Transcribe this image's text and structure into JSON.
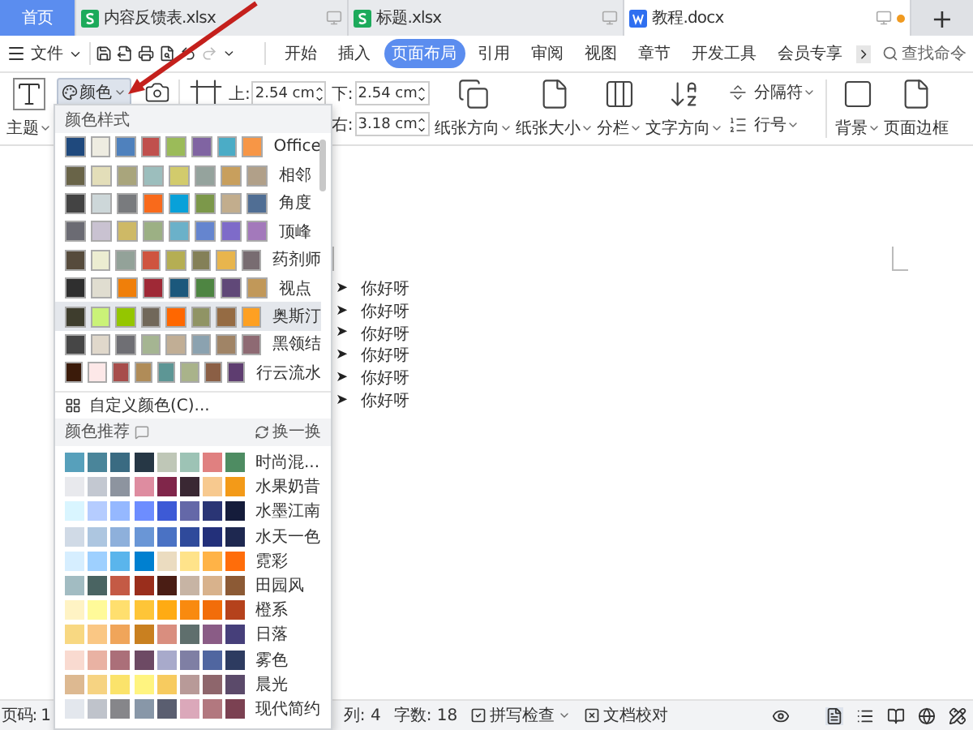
{
  "tabs": [
    {
      "label": "首页",
      "kind": "home",
      "selected": false,
      "modified": false
    },
    {
      "label": "内容反馈表.xlsx",
      "kind": "sheet",
      "selected": false,
      "modified": false
    },
    {
      "label": "标题.xlsx",
      "kind": "sheet",
      "selected": false,
      "modified": false
    },
    {
      "label": "教程.docx",
      "kind": "doc",
      "selected": true,
      "modified": true
    }
  ],
  "new_tab": "+",
  "file_menu": "文件",
  "menu_tabs": [
    {
      "label": "开始",
      "selected": false
    },
    {
      "label": "插入",
      "selected": false
    },
    {
      "label": "页面布局",
      "selected": true
    },
    {
      "label": "引用",
      "selected": false
    },
    {
      "label": "审阅",
      "selected": false
    },
    {
      "label": "视图",
      "selected": false
    },
    {
      "label": "章节",
      "selected": false
    },
    {
      "label": "开发工具",
      "selected": false
    },
    {
      "label": "会员专享",
      "selected": false
    }
  ],
  "search": {
    "placeholder": "查找命令"
  },
  "ribbon": {
    "theme": "主题",
    "color_button": "颜色",
    "margins": [
      {
        "label": "上:",
        "value": "2.54 cm"
      },
      {
        "label": "下:",
        "value": "2.54 cm"
      },
      {
        "label": "右:",
        "value": "3.18 cm"
      }
    ],
    "tools": [
      {
        "label": "纸张方向",
        "kind": "orientation",
        "dropdown": true
      },
      {
        "label": "纸张大小",
        "kind": "size",
        "dropdown": true
      },
      {
        "label": "分栏",
        "kind": "columns",
        "dropdown": true
      },
      {
        "label": "文字方向",
        "kind": "direction",
        "dropdown": true
      },
      {
        "label": "分隔符",
        "kind": "separator",
        "dropdown": true
      },
      {
        "label": "行号",
        "kind": "linenumber",
        "dropdown": true
      },
      {
        "label": "背景",
        "kind": "background",
        "dropdown": true
      },
      {
        "label": "页面边框",
        "kind": "border",
        "dropdown": false
      }
    ]
  },
  "color_menu": {
    "styles_title": "颜色样式",
    "styles": [
      {
        "name": "Office",
        "selected": false,
        "swatches": [
          {
            "color": "#1f497d"
          },
          {
            "color": "#eeece1"
          },
          {
            "color": "#4f81bd"
          },
          {
            "color": "#c0504d"
          },
          {
            "color": "#9bbb59"
          },
          {
            "color": "#8064a2"
          },
          {
            "color": "#4bacc6"
          },
          {
            "color": "#f79646"
          }
        ]
      },
      {
        "name": "相邻",
        "selected": false,
        "swatches": [
          {
            "color": "#696448"
          },
          {
            "color": "#e3deb9"
          },
          {
            "color": "#a9a57c"
          },
          {
            "color": "#9cbebd"
          },
          {
            "color": "#d2cb6c"
          },
          {
            "color": "#95a39d"
          },
          {
            "color": "#c89f5d"
          },
          {
            "color": "#b1a089"
          }
        ]
      },
      {
        "name": "角度",
        "selected": false,
        "swatches": [
          {
            "color": "#434343"
          },
          {
            "color": "#cdd7d9"
          },
          {
            "color": "#797b7e"
          },
          {
            "color": "#f96a1b"
          },
          {
            "color": "#08a1d9"
          },
          {
            "color": "#7c984a"
          },
          {
            "color": "#c2ad8d"
          },
          {
            "color": "#506e94"
          }
        ]
      },
      {
        "name": "顶峰",
        "selected": false,
        "swatches": [
          {
            "color": "#6b6b73"
          },
          {
            "color": "#c9c2d1"
          },
          {
            "color": "#ceb966"
          },
          {
            "color": "#9cb084"
          },
          {
            "color": "#6bb1c9"
          },
          {
            "color": "#6585cf"
          },
          {
            "color": "#7e6bc9"
          },
          {
            "color": "#a379bb"
          }
        ]
      },
      {
        "name": "药剂师",
        "selected": false,
        "swatches": [
          {
            "color": "#564b3c"
          },
          {
            "color": "#ecedd1"
          },
          {
            "color": "#93a299"
          },
          {
            "color": "#cf543f"
          },
          {
            "color": "#b5ae53"
          },
          {
            "color": "#848058"
          },
          {
            "color": "#e8b54d"
          },
          {
            "color": "#786c71"
          }
        ]
      },
      {
        "name": "视点",
        "selected": false,
        "swatches": [
          {
            "color": "#2f2f2f"
          },
          {
            "color": "#e0ddd0"
          },
          {
            "color": "#f07f09"
          },
          {
            "color": "#9f2936"
          },
          {
            "color": "#1b587c"
          },
          {
            "color": "#4e8542"
          },
          {
            "color": "#604878"
          },
          {
            "color": "#c19859"
          }
        ]
      },
      {
        "name": "奥斯汀",
        "selected": true,
        "swatches": [
          {
            "color": "#3e3d2d"
          },
          {
            "color": "#caf278"
          },
          {
            "color": "#94c600"
          },
          {
            "color": "#71685a"
          },
          {
            "color": "#ff6700"
          },
          {
            "color": "#909465"
          },
          {
            "color": "#956b43"
          },
          {
            "color": "#fea022"
          }
        ]
      },
      {
        "name": "黑领结",
        "selected": false,
        "swatches": [
          {
            "color": "#464646"
          },
          {
            "color": "#e0d8cb"
          },
          {
            "color": "#6f6f74"
          },
          {
            "color": "#a5b592"
          },
          {
            "color": "#c1ae95"
          },
          {
            "color": "#8ba2b0"
          },
          {
            "color": "#a08466"
          },
          {
            "color": "#8e6a73"
          }
        ]
      },
      {
        "name": "行云流水",
        "selected": false,
        "swatches": [
          {
            "color": "#3b1b0a"
          },
          {
            "color": "#fde8e8"
          },
          {
            "color": "#a74d4b"
          },
          {
            "color": "#b08c58"
          },
          {
            "color": "#5d9695"
          },
          {
            "color": "#a9b38a"
          },
          {
            "color": "#8b5f45"
          },
          {
            "color": "#5e3d70"
          }
        ]
      }
    ],
    "custom": "自定义颜色(C)...",
    "recommend_title": "颜色推荐",
    "refresh": "换一换",
    "recommended": [
      {
        "name": "时尚混...",
        "swatches": [
          {
            "color": "#57a0bb"
          },
          {
            "color": "#4a859a"
          },
          {
            "color": "#3a6b82"
          },
          {
            "color": "#263745"
          },
          {
            "color": "#bfc7b7"
          },
          {
            "color": "#9dc3b5"
          },
          {
            "color": "#e08080"
          },
          {
            "color": "#4e8c62"
          }
        ]
      },
      {
        "name": "水果奶昔",
        "swatches": [
          {
            "color": "#e8e9ed"
          },
          {
            "color": "#c3c8d1"
          },
          {
            "color": "#8d949f"
          },
          {
            "color": "#de8ca0"
          },
          {
            "color": "#80264a"
          },
          {
            "color": "#3a2833"
          },
          {
            "color": "#f7c98f"
          },
          {
            "color": "#f39a18"
          }
        ]
      },
      {
        "name": "水墨江南",
        "swatches": [
          {
            "color": "#d9f5ff"
          },
          {
            "color": "#b5ccff"
          },
          {
            "color": "#95b8ff"
          },
          {
            "color": "#6d8dff"
          },
          {
            "color": "#3d5ad6"
          },
          {
            "color": "#6468a8"
          },
          {
            "color": "#2a3575"
          },
          {
            "color": "#151c3b"
          }
        ]
      },
      {
        "name": "水天一色",
        "swatches": [
          {
            "color": "#d0dae6"
          },
          {
            "color": "#adc6e0"
          },
          {
            "color": "#8eb0db"
          },
          {
            "color": "#6a96d6"
          },
          {
            "color": "#4a72c4"
          },
          {
            "color": "#2f4a9b"
          },
          {
            "color": "#23307a"
          },
          {
            "color": "#1e2850"
          }
        ]
      },
      {
        "name": "霓彩",
        "swatches": [
          {
            "color": "#d6eeff"
          },
          {
            "color": "#9ed0ff"
          },
          {
            "color": "#5ab5ec"
          },
          {
            "color": "#0080d0"
          },
          {
            "color": "#ebdcc0"
          },
          {
            "color": "#ffe38a"
          },
          {
            "color": "#ffb347"
          },
          {
            "color": "#ff6d0a"
          }
        ]
      },
      {
        "name": "田园风",
        "swatches": [
          {
            "color": "#a2bcc2"
          },
          {
            "color": "#4a6462"
          },
          {
            "color": "#c45a45"
          },
          {
            "color": "#9a2e1c"
          },
          {
            "color": "#4a1d14"
          },
          {
            "color": "#c7b4a4"
          },
          {
            "color": "#d8b28c"
          },
          {
            "color": "#8c5a35"
          }
        ]
      },
      {
        "name": "橙系",
        "swatches": [
          {
            "color": "#fff3c4"
          },
          {
            "color": "#fffa99"
          },
          {
            "color": "#ffdf6e"
          },
          {
            "color": "#fec538"
          },
          {
            "color": "#ffab13"
          },
          {
            "color": "#f98a0f"
          },
          {
            "color": "#f26d0a"
          },
          {
            "color": "#b5421c"
          }
        ]
      },
      {
        "name": "日落",
        "swatches": [
          {
            "color": "#f8d882"
          },
          {
            "color": "#fac784"
          },
          {
            "color": "#f0a55a"
          },
          {
            "color": "#c98020"
          },
          {
            "color": "#d98e7f"
          },
          {
            "color": "#5f6f6d"
          },
          {
            "color": "#8a5c86"
          },
          {
            "color": "#463f7a"
          }
        ]
      },
      {
        "name": "雾色",
        "swatches": [
          {
            "color": "#f9dad0"
          },
          {
            "color": "#e9b2a3"
          },
          {
            "color": "#ab6f79"
          },
          {
            "color": "#6d4a64"
          },
          {
            "color": "#a8aacb"
          },
          {
            "color": "#7f7fa4"
          },
          {
            "color": "#5066a0"
          },
          {
            "color": "#2d3b60"
          }
        ]
      },
      {
        "name": "晨光",
        "swatches": [
          {
            "color": "#ddb991"
          },
          {
            "color": "#f6d382"
          },
          {
            "color": "#fbe36b"
          },
          {
            "color": "#fff480"
          },
          {
            "color": "#f7cb5f"
          },
          {
            "color": "#b89a98"
          },
          {
            "color": "#8e666c"
          },
          {
            "color": "#5b4a6a"
          }
        ]
      },
      {
        "name": "现代简约",
        "swatches": [
          {
            "color": "#e3e7ed"
          },
          {
            "color": "#bfc3cb"
          },
          {
            "color": "#86868a"
          },
          {
            "color": "#8897a8"
          },
          {
            "color": "#5a5e70"
          },
          {
            "color": "#dba8ba"
          },
          {
            "color": "#b2787f"
          },
          {
            "color": "#7b4152"
          }
        ]
      }
    ]
  },
  "document": {
    "bullet": "➤",
    "items": [
      "你好呀",
      "你好呀",
      "你好呀",
      "你好呀",
      "你好呀",
      "你好呀"
    ]
  },
  "status_bar": {
    "page": "页码: 1",
    "column": "列: 4",
    "words": "字数: 18",
    "spell_check": "拼写检查",
    "proofread": "文档校对"
  }
}
